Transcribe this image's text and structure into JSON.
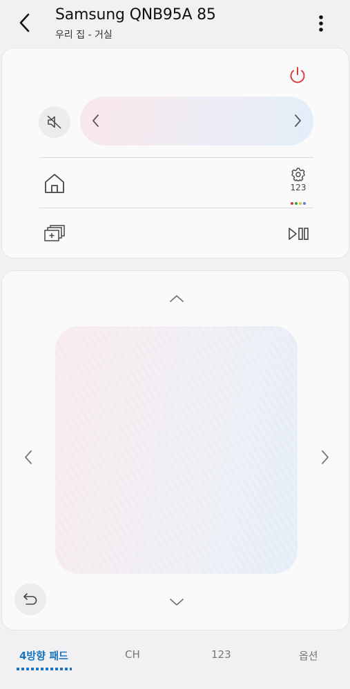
{
  "header": {
    "title": "Samsung QNB95A 85",
    "subtitle": "우리 집 - 거실",
    "back_icon": "chevron-left-icon",
    "more_icon": "more-vertical-icon"
  },
  "remote": {
    "power_icon": "power-icon",
    "power_color": "#d9413c",
    "mute_icon": "mute-icon",
    "volume_down_icon": "chevron-left-icon",
    "volume_up_icon": "chevron-right-icon",
    "home_icon": "home-icon",
    "settings_icon": "gear-icon",
    "settings_label": "123",
    "color_dots": [
      "#d23a3a",
      "#3aa14a",
      "#e8c03a",
      "#4a8ad8"
    ],
    "source_icon": "source-icon",
    "playpause_icon": "play-pause-icon"
  },
  "pad": {
    "up_icon": "chevron-up-icon",
    "down_icon": "chevron-down-icon",
    "left_icon": "chevron-left-icon",
    "right_icon": "chevron-right-icon",
    "return_icon": "return-icon"
  },
  "tabs": [
    {
      "label": "4방향 패드",
      "active": true
    },
    {
      "label": "CH",
      "active": false
    },
    {
      "label": "123",
      "active": false
    },
    {
      "label": "옵션",
      "active": false
    }
  ],
  "colors": {
    "accent": "#1a74bf",
    "background": "#f1f1f3",
    "card": "#fafafa"
  }
}
